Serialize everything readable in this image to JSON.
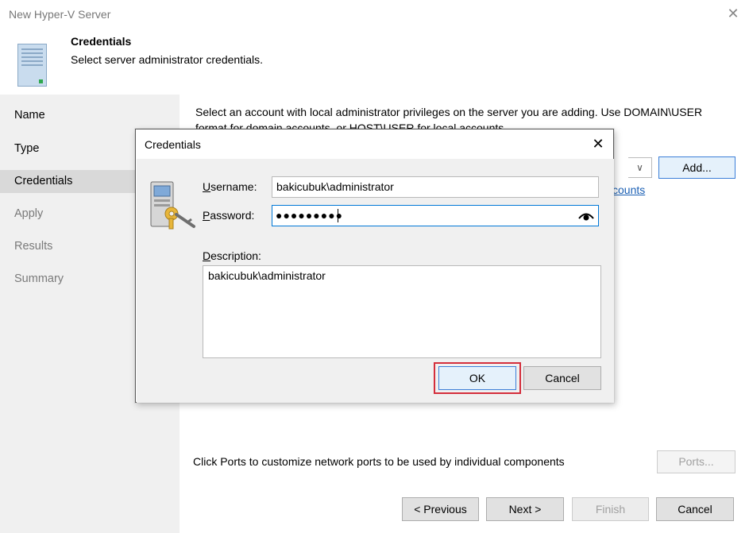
{
  "window": {
    "title": "New Hyper-V Server",
    "close_glyph": "✕"
  },
  "header": {
    "title": "Credentials",
    "subtitle": "Select server administrator credentials.",
    "icon": "server-icon"
  },
  "sidebar": {
    "items": [
      {
        "label": "Name",
        "state": "done"
      },
      {
        "label": "Type",
        "state": "done"
      },
      {
        "label": "Credentials",
        "state": "active"
      },
      {
        "label": "Apply",
        "state": "pending"
      },
      {
        "label": "Results",
        "state": "pending"
      },
      {
        "label": "Summary",
        "state": "pending"
      }
    ]
  },
  "content": {
    "description_line1": "Select an account with local administrator privileges on the server you are adding. Use DOMAIN\\USER",
    "description_line2": "format for domain accounts, or HOST\\USER for local accounts.",
    "add_button": "Add...",
    "link_fragment": "counts",
    "ports_text": "Click Ports to customize network ports to be used by individual components",
    "ports_button": "Ports..."
  },
  "footer": {
    "previous": "< Previous",
    "next": "Next >",
    "finish": "Finish",
    "cancel": "Cancel"
  },
  "dialog": {
    "title": "Credentials",
    "close_glyph": "✕",
    "username_label_key": "U",
    "username_label_rest": "sername:",
    "username_value": "bakicubuk\\administrator",
    "password_label_key": "P",
    "password_label_rest": "assword:",
    "password_mask": "●●●●●●●●●",
    "description_label_key": "D",
    "description_label_rest": "escription:",
    "description_value": "bakicubuk\\administrator",
    "ok_button": "OK",
    "cancel_button": "Cancel",
    "highlight_color": "#d42e3c"
  }
}
